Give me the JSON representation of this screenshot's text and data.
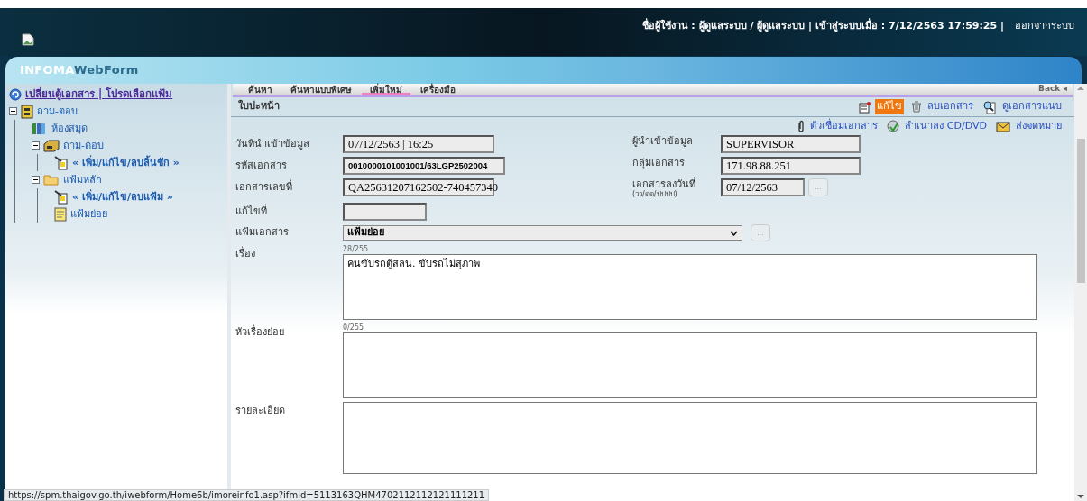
{
  "header": {
    "user_info": "ชื่อผู้ใช้งาน : ผู้ดูแลระบบ / ผู้ดูแลระบบ | เข้าสู่ระบบเมื่อ : 7/12/2563 17:59:25 |",
    "logout": "ออกจากระบบ",
    "logo_part_1": "INFOMA",
    "logo_part_2": "WebForm"
  },
  "sidebar": {
    "switch_link": "เปลี่ยนตู้เอกสาร | โปรดเลือกแฟ้ม",
    "tree": [
      {
        "label": "ถาม-ตอบ",
        "kind": "cabinet",
        "expanded": true,
        "children": [
          {
            "label": "ห้องสมุด",
            "kind": "books"
          },
          {
            "label": "ถาม-ตอบ",
            "kind": "drawer",
            "expanded": true,
            "children": [
              {
                "label": "« เพิ่ม/แก้ไข/ลบลิ้นชัก »",
                "kind": "action"
              }
            ]
          },
          {
            "label": "แฟ้มหลัก",
            "kind": "folder",
            "expanded": true,
            "children": [
              {
                "label": "« เพิ่ม/แก้ไข/ลบแฟ้ม »",
                "kind": "action"
              },
              {
                "label": "แฟ้มย่อย",
                "kind": "file"
              }
            ]
          }
        ]
      }
    ]
  },
  "menu": {
    "tabs": [
      {
        "label": "ค้นหา",
        "selected": false
      },
      {
        "label": "ค้นหาแบบพิเศษ",
        "selected": false
      },
      {
        "label": "เพิ่มใหม่",
        "selected": true
      },
      {
        "label": "เครื่องมือ",
        "selected": false
      }
    ],
    "back": "Back ◂"
  },
  "panel": {
    "title": "ใบปะหน้า",
    "actions_row_1": [
      {
        "label": "แก้ไข",
        "kind": "edit",
        "highlighted": true
      },
      {
        "label": "ลบเอกสาร",
        "kind": "trash",
        "highlighted": false
      },
      {
        "label": "ดูเอกสารแนบ",
        "kind": "view",
        "highlighted": false
      }
    ],
    "actions_row_2": [
      {
        "label": "ตัวเชื่อมเอกสาร",
        "kind": "clip",
        "highlighted": false
      },
      {
        "label": "สำเนาลง CD/DVD",
        "kind": "disc",
        "highlighted": false
      },
      {
        "label": "ส่งจดหมาย",
        "kind": "mail",
        "highlighted": false
      }
    ]
  },
  "form": {
    "rows": [
      {
        "label": "วันที่นำเข้าข้อมูล",
        "value": "07/12/2563 | 16:25",
        "right_label": "ผู้นำเข้าข้อมูล",
        "right_value": "SUPERVISOR"
      },
      {
        "label": "รหัสเอกสาร",
        "value": "0010000101001001/63LGP2502004",
        "right_label": "กลุ่มเอกสาร",
        "right_value": "171.98.88.251"
      },
      {
        "label": "เอกสารเลขที่",
        "value": "QA25631207162502-740457340",
        "right_label": "เอกสารลงวันที่",
        "right_hint": "(วว/ดด/ปปปป)",
        "right_value": "07/12/2563",
        "right_picker": "..."
      },
      {
        "label": "แก้ไขที่"
      }
    ],
    "folder_label": "แฟ้มเอกสาร",
    "folder_value": "แฟ้มย่อย",
    "folder_picker": "...",
    "textareas": [
      {
        "label": "เรื่อง",
        "counter": "28/255",
        "value": "คนขับรถตู้สลน. ขับรถไม่สุภาพ"
      },
      {
        "label": "หัวเรื่องย่อย",
        "counter": "0/255"
      },
      {
        "label": "รายละเอียด"
      }
    ]
  },
  "status_url": "https://spm.thaigov.go.th/iwebform/Home6b/imoreinfo1.asp?ifmid=5113163QHM4702112112121111211"
}
